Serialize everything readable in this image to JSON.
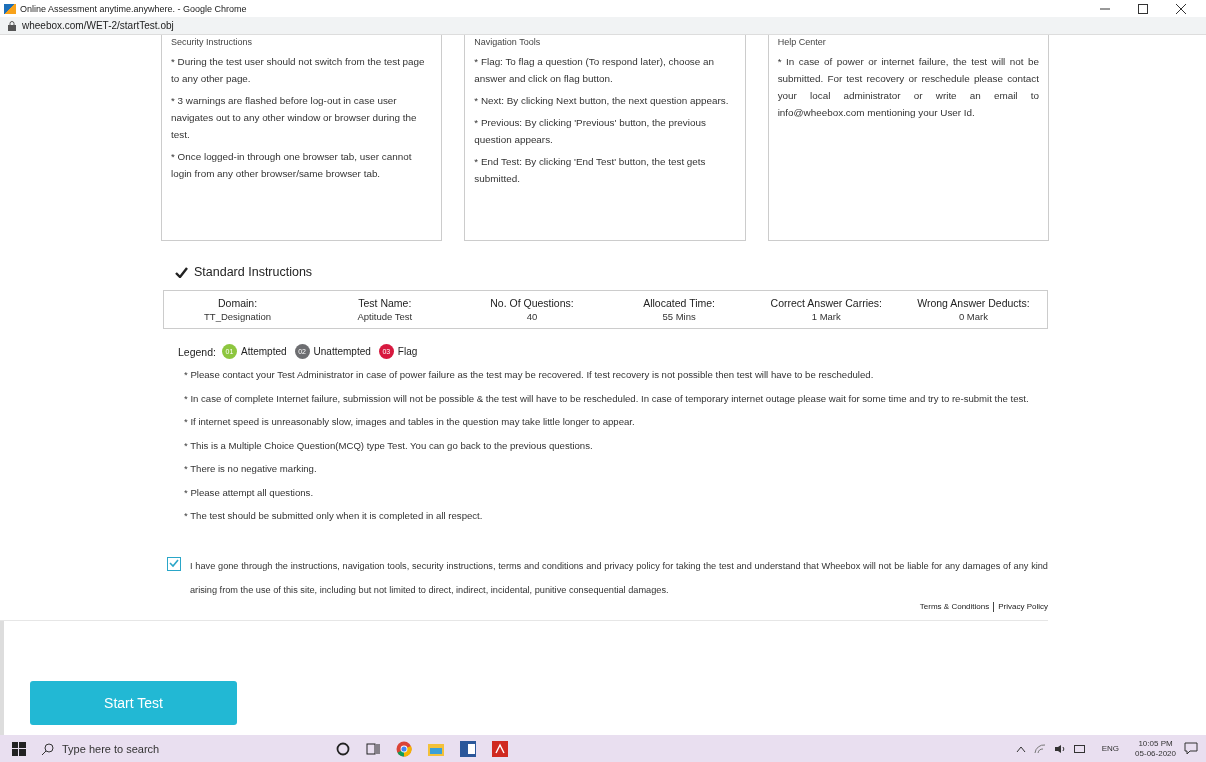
{
  "window": {
    "title": "Online Assessment anytime.anywhere. - Google Chrome",
    "url": "wheebox.com/WET-2/startTest.obj"
  },
  "info_boxes": [
    {
      "heading": "Security Instructions",
      "items": [
        "* During the test user should not switch from the test page to any other page.",
        "* 3 warnings are flashed before log-out in case user navigates out to any other window or browser during the test.",
        "* Once logged-in through one browser tab, user cannot login from any other browser/same browser tab."
      ]
    },
    {
      "heading": "Navigation Tools",
      "items": [
        "* Flag: To flag a question (To respond later), choose an answer and click on flag button.",
        "* Next: By clicking Next button, the next question appears.",
        "* Previous: By clicking 'Previous' button, the previous question appears.",
        "* End Test: By clicking 'End Test' button, the test gets submitted."
      ]
    },
    {
      "heading": "Help Center",
      "items": [
        "* In case of power or internet failure, the test will not be submitted. For test recovery or reschedule please contact your local administrator or write an email to info@wheebox.com mentioning your User Id."
      ]
    }
  ],
  "standard_heading": "Standard Instructions",
  "summary": [
    {
      "label": "Domain:",
      "value": "TT_Designation"
    },
    {
      "label": "Test Name:",
      "value": "Aptitude Test"
    },
    {
      "label": "No. Of Questions:",
      "value": "40"
    },
    {
      "label": "Allocated Time:",
      "value": "55  Mins"
    },
    {
      "label": "Correct Answer Carries:",
      "value": "1 Mark"
    },
    {
      "label": "Wrong Answer Deducts:",
      "value": "0 Mark"
    }
  ],
  "legend": {
    "label": "Legend:",
    "items": [
      {
        "number": "01",
        "text": "Attempted",
        "color": "#8dc63f"
      },
      {
        "number": "02",
        "text": "Unattempted",
        "color": "#6d6e71"
      },
      {
        "number": "03",
        "text": "Flag",
        "color": "#d7193f"
      }
    ]
  },
  "instructions": [
    "* Please contact your Test Administrator in case of power failure as the test may be recovered. If test recovery is not possible then test will have to be rescheduled.",
    "* In case of complete Internet failure, submission will not be possible & the test will have to be rescheduled. In case of temporary internet outage please wait for some time and try to re-submit the test.",
    "* If internet speed is unreasonably slow, images and tables in the question may take little longer to appear.",
    "* This is a Multiple Choice Question(MCQ) type Test. You can go back to the previous questions.",
    "* There is no negative marking.",
    "* Please attempt all questions.",
    "* The test should be submitted only when it is completed in all respect."
  ],
  "agreement": {
    "checked": true,
    "text": "I have gone through the instructions, navigation tools, security instructions, terms and conditions and privacy policy for taking the test and understand that Wheebox will not be liable for any damages of any kind arising from the use of this site, including but not limited to direct, indirect, incidental, punitive consequential damages."
  },
  "links": [
    "Terms & Conditions",
    "Privacy Policy"
  ],
  "start_button": "Start Test",
  "taskbar": {
    "search_placeholder": "Type here to search",
    "language": "ENG",
    "time": "10:05 PM",
    "date": "05-06-2020"
  }
}
